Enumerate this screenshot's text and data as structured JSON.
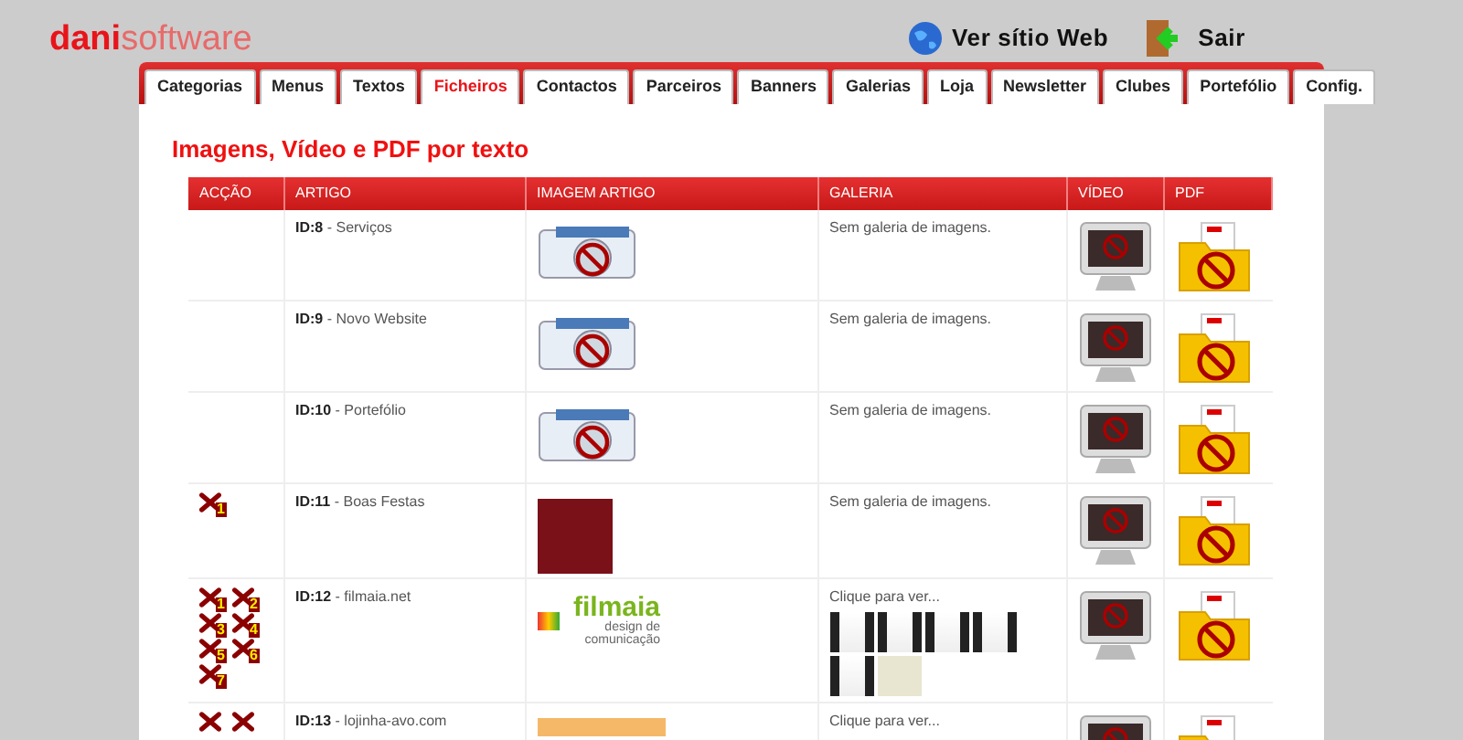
{
  "logo": {
    "bold": "dani",
    "rest": "software"
  },
  "header_links": [
    {
      "kind": "globe",
      "label": "Ver sítio Web"
    },
    {
      "kind": "exit",
      "label": "Sair"
    }
  ],
  "tabs": [
    {
      "label": "Categorias",
      "selected": false
    },
    {
      "label": "Menus",
      "selected": false
    },
    {
      "label": "Textos",
      "selected": false
    },
    {
      "label": "Ficheiros",
      "selected": true
    },
    {
      "label": "Contactos",
      "selected": false
    },
    {
      "label": "Parceiros",
      "selected": false
    },
    {
      "label": "Banners",
      "selected": false
    },
    {
      "label": "Galerias",
      "selected": false
    },
    {
      "label": "Loja",
      "selected": false
    },
    {
      "label": "Newsletter",
      "selected": false
    },
    {
      "label": "Clubes",
      "selected": false
    },
    {
      "label": "Portefólio",
      "selected": false
    },
    {
      "label": "Config.",
      "selected": false
    }
  ],
  "page_title": "Imagens, Vídeo e PDF por texto",
  "table": {
    "columns": [
      "ACÇÃO",
      "ARTIGO",
      "IMAGEM ARTIGO",
      "GALERIA",
      "VÍDEO",
      "PDF"
    ],
    "rows": [
      {
        "actions": [],
        "id": "ID:8",
        "title": " - Serviços",
        "image": {
          "kind": "none"
        },
        "gallery": {
          "kind": "empty",
          "text": "Sem galeria de imagens."
        }
      },
      {
        "actions": [],
        "id": "ID:9",
        "title": " - Novo Website",
        "image": {
          "kind": "none"
        },
        "gallery": {
          "kind": "empty",
          "text": "Sem galeria de imagens."
        }
      },
      {
        "actions": [],
        "id": "ID:10",
        "title": " - Portefólio",
        "image": {
          "kind": "none"
        },
        "gallery": {
          "kind": "empty",
          "text": "Sem galeria de imagens."
        }
      },
      {
        "actions": [
          {
            "kind": "delete",
            "label": "1"
          }
        ],
        "id": "ID:11",
        "title": " - Boas Festas",
        "image": {
          "kind": "festive"
        },
        "gallery": {
          "kind": "empty",
          "text": "Sem galeria de imagens."
        }
      },
      {
        "actions": [
          {
            "kind": "delete",
            "label": "1"
          },
          {
            "kind": "delete",
            "label": "2"
          },
          {
            "kind": "delete",
            "label": "3"
          },
          {
            "kind": "delete",
            "label": "4"
          },
          {
            "kind": "delete",
            "label": "5"
          },
          {
            "kind": "delete",
            "label": "6"
          },
          {
            "kind": "delete",
            "label": "7"
          }
        ],
        "id": "ID:12",
        "title": " - filmaia.net",
        "image": {
          "kind": "logo",
          "name": "filmaia",
          "tagline": "design de comunicação"
        },
        "gallery": {
          "kind": "thumbs",
          "text": "Clique para ver...",
          "thumbs": [
            {
              "kind": "dark"
            },
            {
              "kind": "dark"
            },
            {
              "kind": "dark"
            },
            {
              "kind": "dark"
            },
            {
              "kind": "dark"
            },
            {
              "kind": "light"
            }
          ]
        }
      },
      {
        "actions": [
          {
            "kind": "delete"
          },
          {
            "kind": "delete"
          }
        ],
        "id": "ID:13",
        "title": " - lojinha-avo.com",
        "image": {
          "kind": "orange"
        },
        "gallery": {
          "kind": "thumbs",
          "text": "Clique para ver..."
        }
      }
    ]
  }
}
